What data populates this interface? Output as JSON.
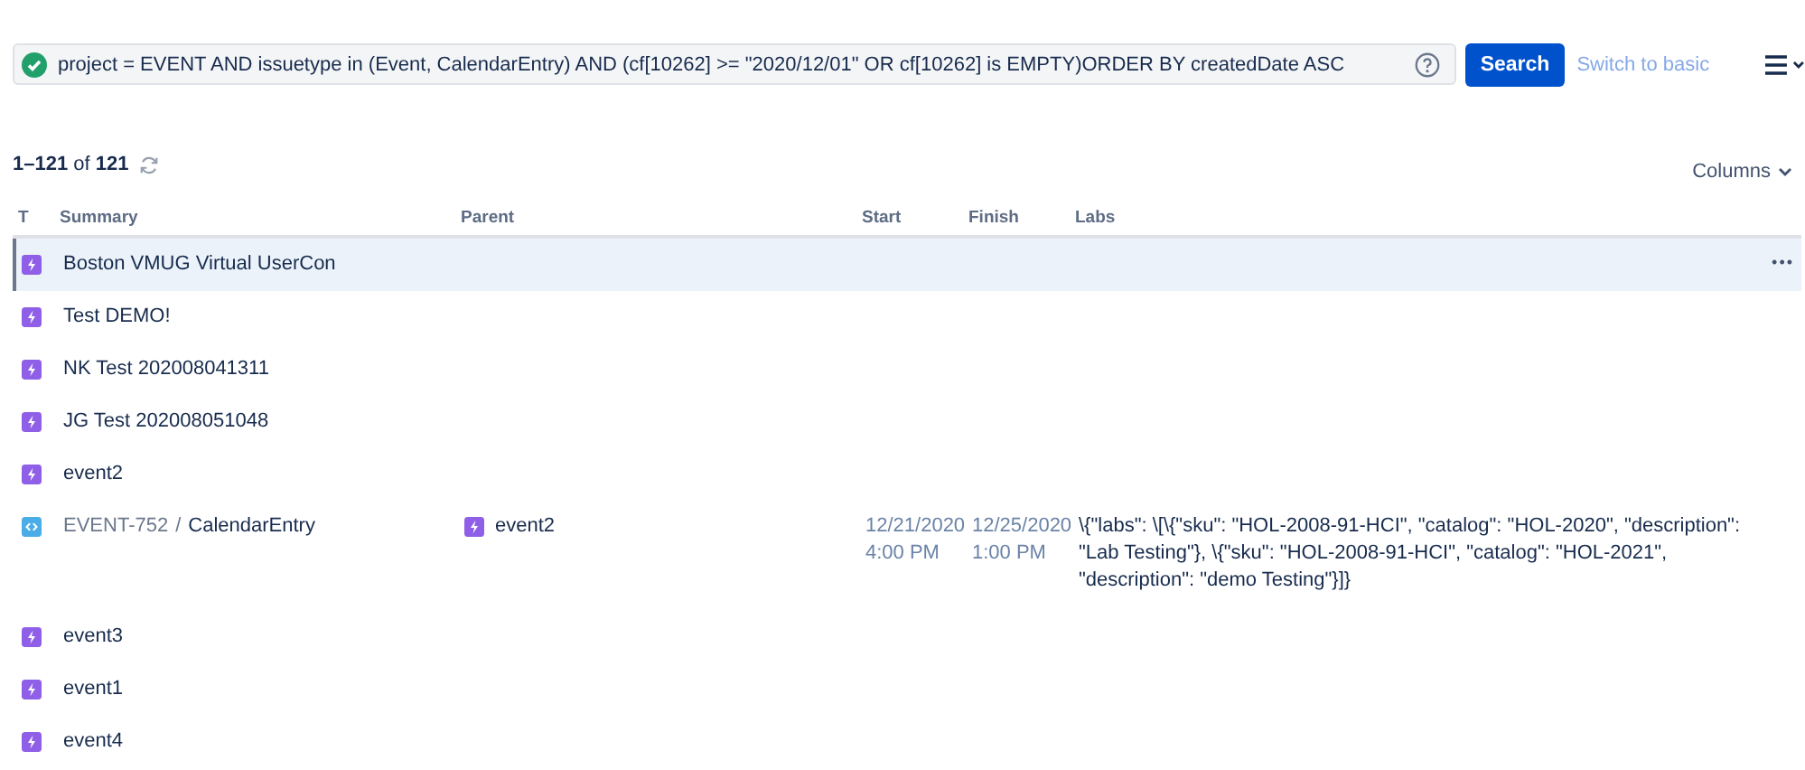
{
  "query": {
    "valid": true,
    "value": "project = EVENT AND issuetype in (Event, CalendarEntry) AND (cf[10262] >= \"2020/12/01\" OR cf[10262] is EMPTY)ORDER BY createdDate ASC"
  },
  "search_button": "Search",
  "switch_link": "Switch to basic",
  "count": {
    "range": "1–121",
    "of": "of",
    "total": "121"
  },
  "columns_button": "Columns",
  "table": {
    "columns": [
      "T",
      "Summary",
      "Parent",
      "Start",
      "Finish",
      "Labs"
    ],
    "rows": [
      {
        "kind": "event",
        "summary": "Boston VMUG Virtual UserCon",
        "selected": true,
        "more": "•••"
      },
      {
        "kind": "event",
        "summary": "Test DEMO!",
        "selected": false
      },
      {
        "kind": "event",
        "summary": "NK Test 202008041311",
        "selected": false
      },
      {
        "kind": "event",
        "summary": "JG Test 202008051048",
        "selected": false
      },
      {
        "kind": "event",
        "summary": "event2",
        "selected": false
      },
      {
        "kind": "calendar",
        "key": "EVENT-752",
        "separator": "/",
        "summary": "CalendarEntry",
        "selected": false,
        "parent": {
          "kind": "event",
          "summary": "event2"
        },
        "start": "12/21/2020 4:00 PM",
        "finish": "12/25/2020 1:00 PM",
        "labs": "\\{\"labs\": \\[\\{\"sku\": \"HOL-2008-91-HCI\", \"catalog\": \"HOL-2020\", \"description\": \"Lab Testing\"}, \\{\"sku\": \"HOL-2008-91-HCI\", \"catalog\": \"HOL-2021\", \"description\": \"demo Testing\"}]}"
      },
      {
        "kind": "event",
        "summary": "event3",
        "selected": false
      },
      {
        "kind": "event",
        "summary": "event1",
        "selected": false
      },
      {
        "kind": "event",
        "summary": "event4",
        "selected": false
      }
    ]
  }
}
